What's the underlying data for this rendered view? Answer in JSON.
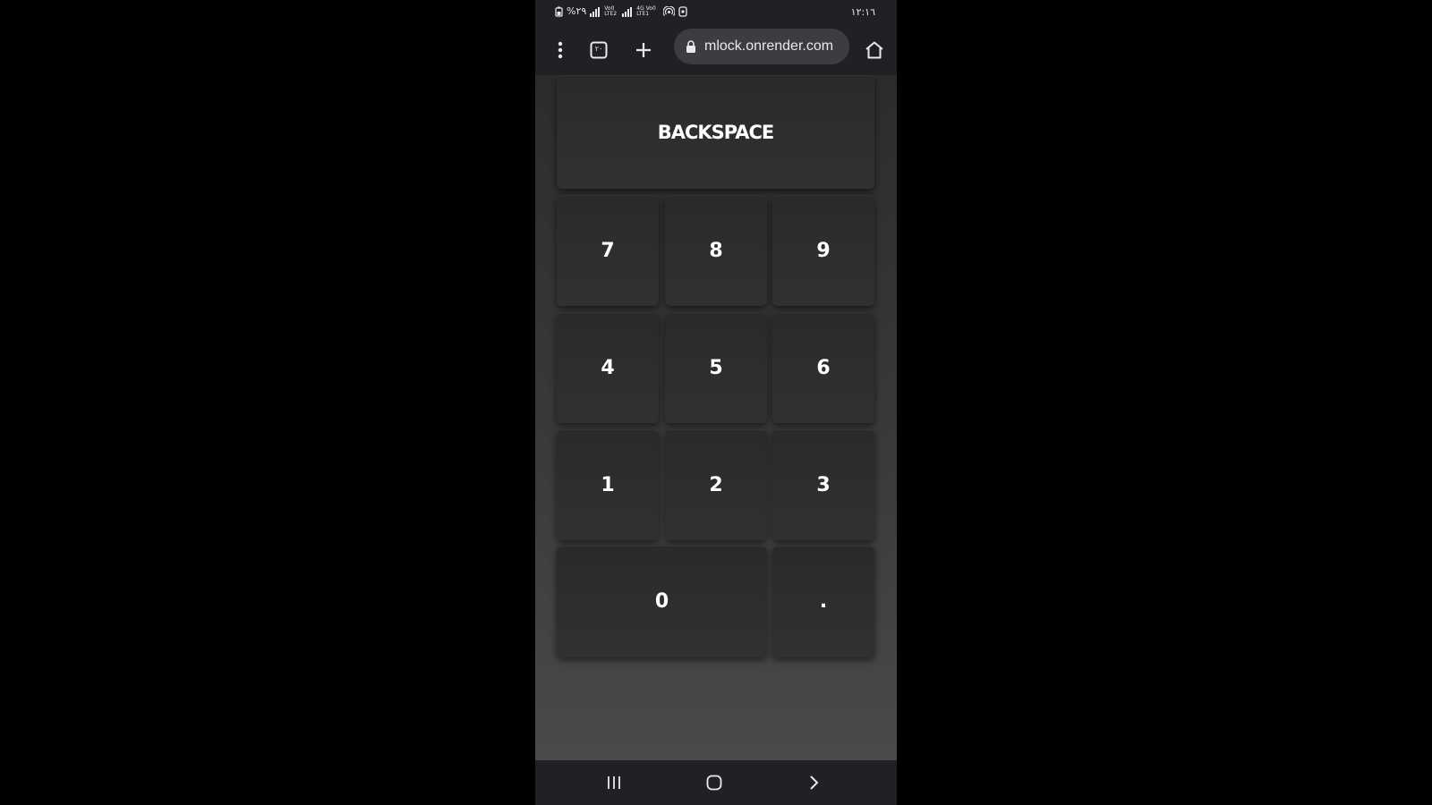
{
  "status_bar": {
    "left_text": "%٢٩",
    "network_labels": [
      "Vo0 LTE2",
      "4G Vo0 LTE1"
    ],
    "time": "١٢:١٦"
  },
  "browser": {
    "url": "mlock.onrender.com",
    "tab_count": "٢٠",
    "icons": [
      "more-vert-icon",
      "tabs-icon",
      "plus-icon",
      "lock-icon",
      "home-icon"
    ]
  },
  "keypad": {
    "backspace_label": "BACKSPACE",
    "keys": {
      "k7": "7",
      "k8": "8",
      "k9": "9",
      "k4": "4",
      "k5": "5",
      "k6": "6",
      "k1": "1",
      "k2": "2",
      "k3": "3",
      "k0": "0",
      "kdot": "."
    }
  },
  "nav_bar": {
    "icons": [
      "recents-icon",
      "home-circle-icon",
      "back-chevron-icon"
    ]
  },
  "colors": {
    "background": "#000000",
    "chrome": "#202124",
    "url_bar": "#3c3d41",
    "key": "#2e2e2e",
    "key_text": "#ffffff"
  }
}
